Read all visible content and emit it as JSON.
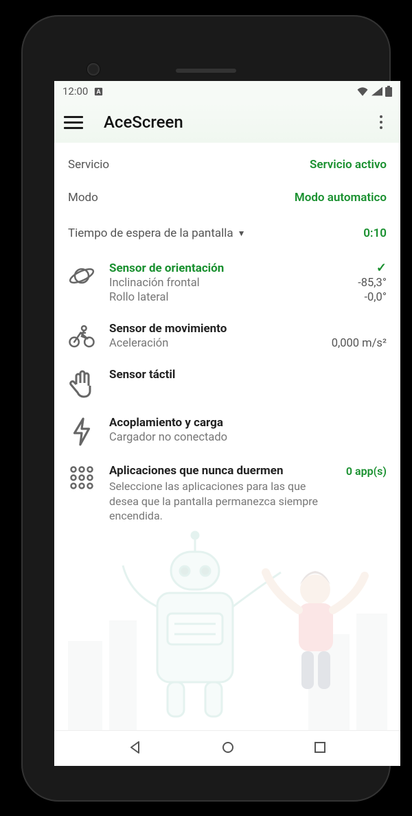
{
  "status": {
    "time": "12:00",
    "auto_rotate_icon": "A"
  },
  "app": {
    "title": "AceScreen"
  },
  "header": {
    "service_label": "Servicio",
    "service_value": "Servicio activo",
    "mode_label": "Modo",
    "mode_value": "Modo automatico",
    "timeout_label": "Tiempo de espera de la pantalla",
    "timeout_value": "0:10"
  },
  "sensors": {
    "orientation": {
      "title": "Sensor de orientación",
      "active_check": "✓",
      "tilt_label": "Inclinación frontal",
      "tilt_value": "-85,3°",
      "roll_label": "Rollo lateral",
      "roll_value": "-0,0°"
    },
    "motion": {
      "title": "Sensor de movimiento",
      "accel_label": "Aceleración",
      "accel_value": "0,000 m/s²"
    },
    "touch": {
      "title": "Sensor táctil"
    },
    "charging": {
      "title": "Acoplamiento y carga",
      "status": "Cargador no conectado"
    },
    "apps": {
      "title": "Aplicaciones que nunca duermen",
      "count": "0 app(s)",
      "description": "Seleccione las aplicaciones para las que desea que la pantalla permanezca siempre encendida."
    }
  }
}
